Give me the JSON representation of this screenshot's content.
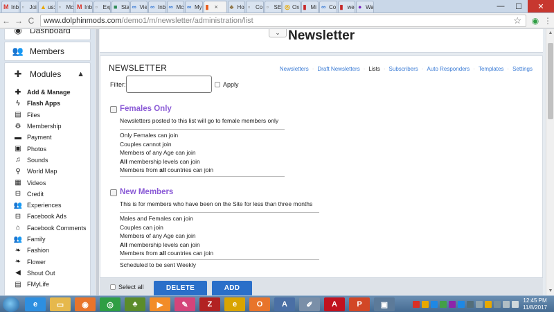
{
  "browser": {
    "tabs": [
      {
        "label": "Inb",
        "color": "#d93025",
        "glyph": "M"
      },
      {
        "label": "Joi",
        "color": "#777777",
        "glyph": "▫"
      },
      {
        "label": "us:",
        "color": "#e8a800",
        "glyph": "▲"
      },
      {
        "label": "Mc",
        "color": "#777777",
        "glyph": "▫"
      },
      {
        "label": "Inb",
        "color": "#d93025",
        "glyph": "M"
      },
      {
        "label": "Exp",
        "color": "#777777",
        "glyph": "▫"
      },
      {
        "label": "Sta",
        "color": "#2e8b57",
        "glyph": "■"
      },
      {
        "label": "Vie",
        "color": "#3a7bd5",
        "glyph": "∞"
      },
      {
        "label": "Inb",
        "color": "#3a7bd5",
        "glyph": "∞"
      },
      {
        "label": "Mc",
        "color": "#3a7bd5",
        "glyph": "∞"
      },
      {
        "label": "My",
        "color": "#3a7bd5",
        "glyph": "∞"
      },
      {
        "label": "",
        "color": "#e85a1a",
        "glyph": "▮",
        "active": true
      },
      {
        "label": "Ho",
        "color": "#8a6d3b",
        "glyph": "♣"
      },
      {
        "label": "Co",
        "color": "#777777",
        "glyph": "▫"
      },
      {
        "label": "SE",
        "color": "#777777",
        "glyph": "▫"
      },
      {
        "label": "Ox",
        "color": "#e8a800",
        "glyph": "◎"
      },
      {
        "label": "Mi",
        "color": "#c62828",
        "glyph": "▮"
      },
      {
        "label": "Co",
        "color": "#3a7bd5",
        "glyph": "∞"
      },
      {
        "label": "we",
        "color": "#c62828",
        "glyph": "▮"
      },
      {
        "label": "Wa",
        "color": "#7b2cbf",
        "glyph": "●"
      }
    ],
    "url_host": "www.dolphinmods.com",
    "url_path": "/demo1/m/newsletter/administration/list",
    "back": "←",
    "forward": "→",
    "reload": "C",
    "star": "☆",
    "window_min": "—",
    "window_max": "☐",
    "window_close": "✕"
  },
  "sidebar": {
    "dashboard": {
      "label": "Dashboard",
      "icon": "dashboard-icon",
      "glyph": "◉"
    },
    "members": {
      "label": "Members",
      "icon": "users-icon",
      "glyph": "👥"
    },
    "modules": {
      "label": "Modules",
      "icon": "puzzle-icon",
      "glyph": "✚",
      "chevron": "▲"
    },
    "module_items": [
      {
        "label": "Add & Manage",
        "glyph": "✚",
        "bold": true
      },
      {
        "label": "Flash Apps",
        "glyph": "ϟ",
        "bold": true
      },
      {
        "label": "Files",
        "glyph": "▤"
      },
      {
        "label": "Membership",
        "glyph": "⚙"
      },
      {
        "label": "Payment",
        "glyph": "▬"
      },
      {
        "label": "Photos",
        "glyph": "▣"
      },
      {
        "label": "Sounds",
        "glyph": "♫"
      },
      {
        "label": "World Map",
        "glyph": "⚲"
      },
      {
        "label": "Videos",
        "glyph": "▦"
      },
      {
        "label": "Credit",
        "glyph": "⊟"
      },
      {
        "label": "Experiences",
        "glyph": "👥"
      },
      {
        "label": "Facebook Ads",
        "glyph": "⊟"
      },
      {
        "label": "Facebook Comments",
        "glyph": "⌂"
      },
      {
        "label": "Family",
        "glyph": "👥"
      },
      {
        "label": "Fashion",
        "glyph": "❧"
      },
      {
        "label": "Flower",
        "glyph": "❧"
      },
      {
        "label": "Shout Out",
        "glyph": "◀"
      },
      {
        "label": "FMyLife",
        "glyph": "▤"
      }
    ]
  },
  "header": {
    "title": "Newsletter",
    "dropdown_glyph": "⌄"
  },
  "newsletter": {
    "section_title": "NEWSLETTER",
    "subnav": [
      "Newsletters",
      "Draft Newsletters",
      "Lists",
      "Subscribers",
      "Auto Responders",
      "Templates",
      "Settings"
    ],
    "subnav_current": "Lists",
    "filter_label": "Filter:",
    "filter_value": "",
    "apply_label": "Apply",
    "lists": [
      {
        "name": "Females Only",
        "description": "Newsletters posted to this list will go to female members only",
        "rules": [
          "Only Females can join",
          "Couples cannot join",
          "Members of any Age can join",
          "All membership levels can join",
          "Members from all countries can join"
        ],
        "schedule": ""
      },
      {
        "name": "New Members",
        "description": "This is for members who have been on the Site for less than three months",
        "rules": [
          "Males and Females can join",
          "Couples can join",
          "Members of any Age can join",
          "All membership levels can join",
          "Members from all countries can join"
        ],
        "schedule": "Scheduled to be sent Weekly"
      }
    ],
    "select_all_label": "Select all",
    "delete_label": "DELETE",
    "add_label": "ADD"
  },
  "taskbar": {
    "apps": [
      {
        "name": "ie-icon",
        "color": "#2d8fe0",
        "glyph": "e"
      },
      {
        "name": "explorer-icon",
        "color": "#e6b84c",
        "glyph": "▭"
      },
      {
        "name": "firefox-icon",
        "color": "#e8742b",
        "glyph": "◉"
      },
      {
        "name": "chrome-icon",
        "color": "#2f9e44",
        "glyph": "◎"
      },
      {
        "name": "frog-icon",
        "color": "#5b8c2a",
        "glyph": "♣"
      },
      {
        "name": "media-icon",
        "color": "#f28c28",
        "glyph": "▶"
      },
      {
        "name": "paint-icon",
        "color": "#d4447a",
        "glyph": "✎"
      },
      {
        "name": "filezilla-icon",
        "color": "#b22222",
        "glyph": "Z"
      },
      {
        "name": "ecma-icon",
        "color": "#d9a400",
        "glyph": "e"
      },
      {
        "name": "outlook-icon",
        "color": "#e8742b",
        "glyph": "O"
      },
      {
        "name": "font-icon",
        "color": "#4a6fa5",
        "glyph": "A"
      },
      {
        "name": "pen-icon",
        "color": "#7a8fa8",
        "glyph": "✐"
      },
      {
        "name": "acrobat-icon",
        "color": "#c1121f",
        "glyph": "A"
      },
      {
        "name": "powerpoint-icon",
        "color": "#d24726",
        "glyph": "P"
      },
      {
        "name": "network-icon",
        "color": "#5c7a99",
        "glyph": "▣"
      }
    ],
    "tray_colors": [
      "#d93025",
      "#e8a800",
      "#1e88e5",
      "#43a047",
      "#8e24aa",
      "#1e88e5",
      "#546e7a",
      "#90a4ae",
      "#e8a800",
      "#78909c",
      "#b0bec5",
      "#cfd8dc"
    ],
    "time": "12:45 PM",
    "date": "11/8/2017"
  }
}
